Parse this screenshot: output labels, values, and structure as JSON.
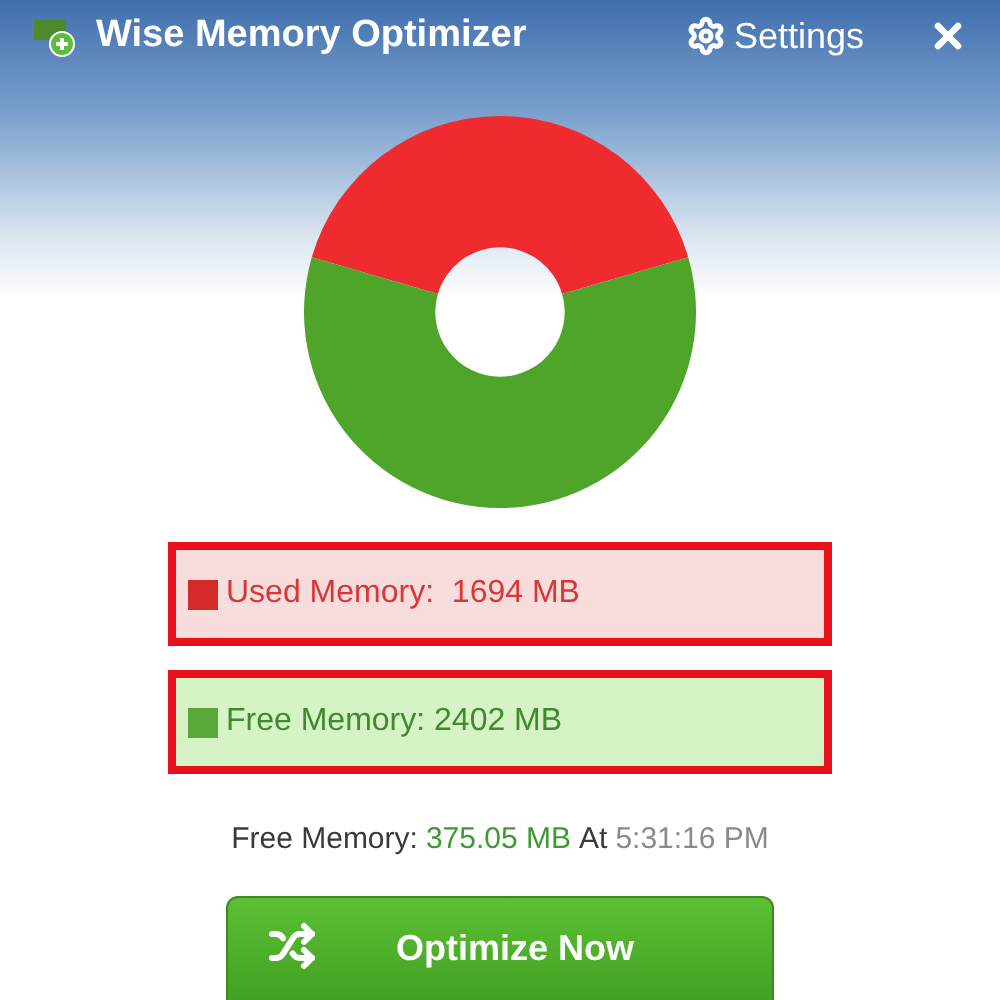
{
  "window": {
    "title": "Wise Memory Optimizer",
    "settings": "Settings"
  },
  "legend": [
    {
      "kind": "used",
      "text": "Used Memory:  1694 MB",
      "color": "#d42a2a"
    },
    {
      "kind": "free",
      "text": "Free Memory: 2402 MB",
      "color": "#5aa83a"
    }
  ],
  "status": [
    {
      "kind": "label",
      "text": "Free Memory:"
    },
    {
      "kind": "value",
      "text": "375.05 MB"
    },
    {
      "kind": "label",
      "text": "At"
    },
    {
      "kind": "time",
      "text": "5:31:16 PM"
    }
  ],
  "button": {
    "label": "Optimize Now"
  }
}
